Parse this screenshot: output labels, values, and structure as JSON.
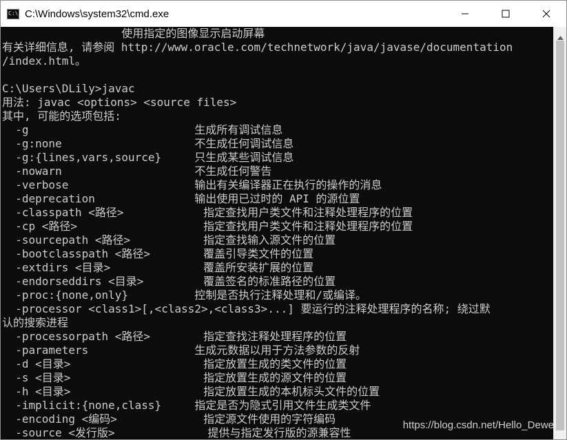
{
  "window": {
    "title": "C:\\Windows\\system32\\cmd.exe",
    "app_icon_text": "C:\\_",
    "controls": [
      "minimize-icon",
      "maximize-icon",
      "close-icon"
    ]
  },
  "console": {
    "text_color": "#cccccc",
    "background": "#0c0c0c",
    "lines": [
      "                  使用指定的图像显示启动屏幕",
      "有关详细信息, 请参阅 http://www.oracle.com/technetwork/java/javase/documentation",
      "/index.html。",
      "",
      "C:\\Users\\DLily>javac",
      "用法: javac <options> <source files>",
      "其中, 可能的选项包括:",
      "  -g                         生成所有调试信息",
      "  -g:none                    不生成任何调试信息",
      "  -g:{lines,vars,source}     只生成某些调试信息",
      "  -nowarn                    不生成任何警告",
      "  -verbose                   输出有关编译器正在执行的操作的消息",
      "  -deprecation               输出使用已过时的 API 的源位置",
      "  -classpath <路径>            指定查找用户类文件和注释处理程序的位置",
      "  -cp <路径>                   指定查找用户类文件和注释处理程序的位置",
      "  -sourcepath <路径>           指定查找输入源文件的位置",
      "  -bootclasspath <路径>        覆盖引导类文件的位置",
      "  -extdirs <目录>              覆盖所安装扩展的位置",
      "  -endorseddirs <目录>         覆盖签名的标准路径的位置",
      "  -proc:{none,only}          控制是否执行注释处理和/或编译。",
      "  -processor <class1>[,<class2>,<class3>...] 要运行的注释处理程序的名称; 绕过默",
      "认的搜索进程",
      "  -processorpath <路径>        指定查找注释处理程序的位置",
      "  -parameters                生成元数据以用于方法参数的反射",
      "  -d <目录>                    指定放置生成的类文件的位置",
      "  -s <目录>                    指定放置生成的源文件的位置",
      "  -h <目录>                    指定放置生成的本机标头文件的位置",
      "  -implicit:{none,class}     指定是否为隐式引用文件生成类文件",
      "  -encoding <编码>             指定源文件使用的字符编码",
      "  -source <发行版>              提供与指定发行版的源兼容性"
    ]
  },
  "scrollbar": {
    "up_arrow": "▲"
  },
  "watermark": "https://blog.csdn.net/Hello_Dewe"
}
